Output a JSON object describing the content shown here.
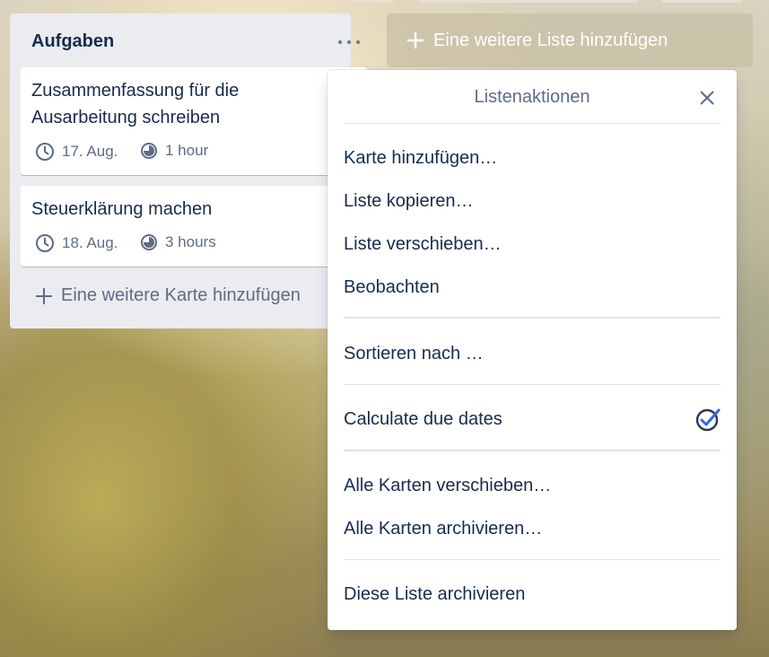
{
  "board": {
    "add_list_label": "Eine weitere Liste hinzufügen"
  },
  "list": {
    "title": "Aufgaben",
    "add_card_label": "Eine weitere Karte hinzufügen",
    "cards": [
      {
        "title_line1": "Zusammenfassung für die",
        "title_line2": "Ausarbeitung schreiben",
        "due": "17. Aug.",
        "estimate": "1 hour"
      },
      {
        "title": "Steuerklärung machen",
        "due": "18. Aug.",
        "estimate": "3 hours"
      }
    ]
  },
  "popover": {
    "title": "Listenaktionen",
    "close_icon": "close-icon",
    "groups": [
      [
        "Karte hinzufügen…",
        "Liste kopieren…",
        "Liste verschieben…",
        "Beobachten"
      ],
      [
        "Sortieren nach …"
      ],
      [
        "Calculate due dates"
      ],
      [
        "Alle Karten verschieben…",
        "Alle Karten archivieren…"
      ],
      [
        "Diese Liste archivieren"
      ]
    ],
    "powerup_icon": "check-clock-icon"
  },
  "colors": {
    "text_primary": "#172b4d",
    "text_muted": "#5e6c84",
    "list_bg": "#ebecf0",
    "card_bg": "#ffffff"
  }
}
